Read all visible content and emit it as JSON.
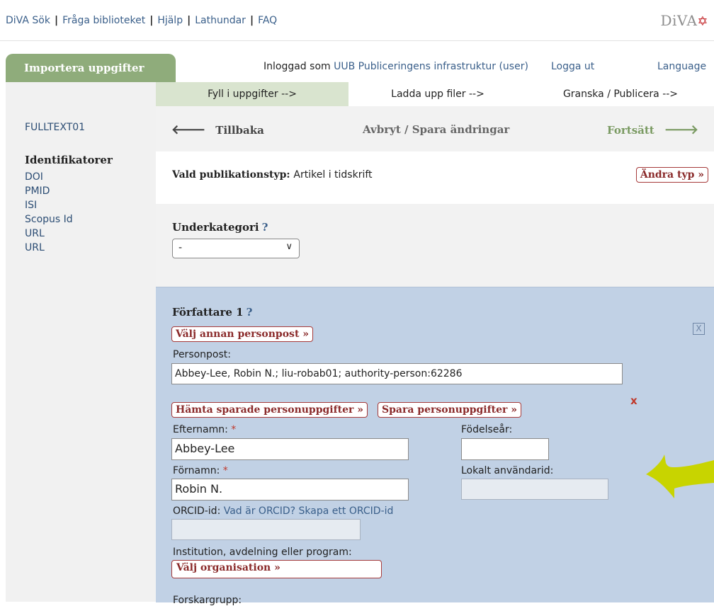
{
  "topnav": {
    "links": [
      "DiVA Sök",
      "Fråga biblioteket",
      "Hjälp",
      "Lathundar",
      "FAQ"
    ],
    "brand": "DiVA"
  },
  "header": {
    "import_tab": "Importera uppgifter",
    "logged_in_prefix": "Inloggad som",
    "logged_in_user": "UUB Publiceringens infrastruktur (user)",
    "logout": "Logga ut",
    "language": "Language"
  },
  "sidebar": {
    "fulltext": "FULLTEXT01",
    "identifiers_heading": "Identifikatorer",
    "identifiers": [
      "DOI",
      "PMID",
      "ISI",
      "Scopus Id",
      "URL",
      "URL"
    ]
  },
  "steps": {
    "step1": "Fyll i uppgifter -->",
    "step2": "Ladda upp filer -->",
    "step3": "Granska / Publicera -->"
  },
  "nav": {
    "back": "Tillbaka",
    "cancel_save": "Avbryt / Spara ändringar",
    "forward": "Fortsätt"
  },
  "pubtype": {
    "label": "Vald publikationstyp:",
    "value": "Artikel i tidskrift",
    "change_button": "Ändra typ »"
  },
  "subcategory": {
    "label": "Underkategori",
    "help": "?",
    "selected": "-"
  },
  "author": {
    "title": "Författare 1",
    "help": "?",
    "close_label": "X",
    "choose_person_button": "Välj annan personpost »",
    "personpost_label": "Personpost:",
    "personpost_value": "Abbey-Lee, Robin N.; liu-robab01; authority-person:62286",
    "remove_mark": "x",
    "fetch_saved_button": "Hämta sparade personuppgifter »",
    "save_person_button": "Spara personuppgifter »",
    "lastname_label": "Efternamn:",
    "lastname_value": "Abbey-Lee",
    "birthyear_label": "Födelseår:",
    "birthyear_value": "",
    "firstname_label": "Förnamn:",
    "firstname_value": "Robin N.",
    "local_id_label": "Lokalt användarid:",
    "local_id_value": "",
    "required_mark": "*",
    "orcid_label": "ORCID-id:",
    "orcid_what": "Vad är ORCID?",
    "orcid_create": "Skapa ett ORCID-id",
    "orcid_value": "",
    "institution_label": "Institution, avdelning eller program:",
    "choose_org_button": "Välj organisation »",
    "research_group_label": "Forskargrupp:"
  },
  "colors": {
    "accent_green": "#8fac7b",
    "author_bg": "#c1d1e5",
    "arrow_highlight": "#c8d400",
    "button_border": "#a63a3a"
  }
}
